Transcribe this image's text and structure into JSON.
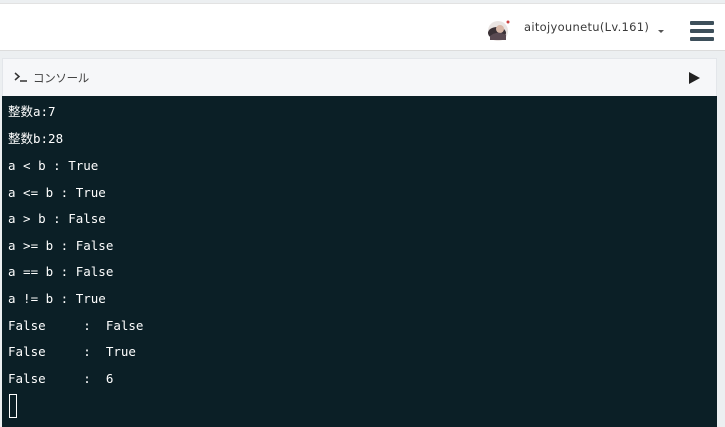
{
  "header": {
    "username": "aitojyounetu(Lv.161)",
    "avatar_icon": "user-avatar",
    "menu_icon": "hamburger-menu-icon"
  },
  "console": {
    "title": "コンソール",
    "prompt_icon": "terminal-prompt-icon",
    "run_icon": "play-icon",
    "colors": {
      "background": "#0b1f26",
      "text": "#ffffff"
    }
  },
  "output": {
    "lines": [
      "整数a:7",
      "整数b:28",
      "a < b : True",
      "a <= b : True",
      "a > b : False",
      "a >= b : False",
      "a == b : False",
      "a != b : True",
      "False     :  False",
      "False     :  True",
      "False     :  6"
    ]
  }
}
